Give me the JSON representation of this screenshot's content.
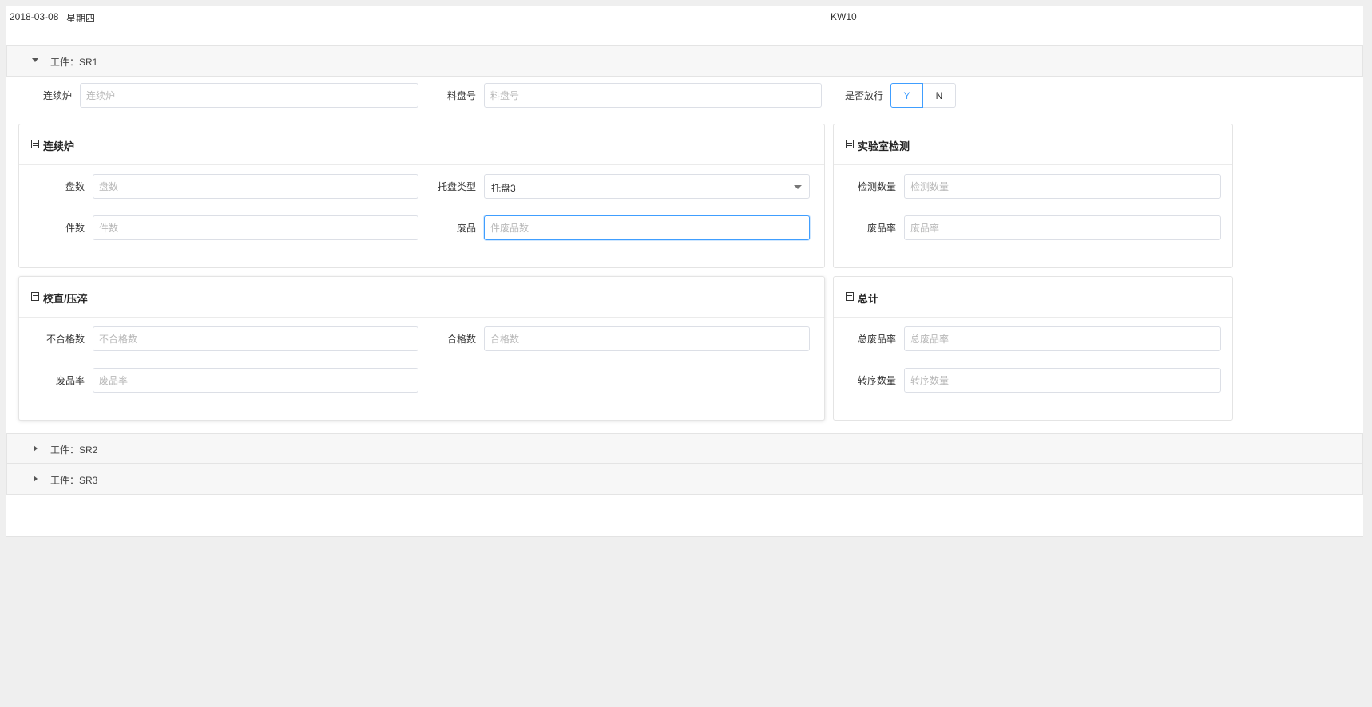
{
  "header": {
    "date": "2018-03-08",
    "weekday": "星期四",
    "week": "KW10"
  },
  "sections": [
    {
      "title": "工件：SR1",
      "expanded": true
    },
    {
      "title": "工件：SR2",
      "expanded": false
    },
    {
      "title": "工件：SR3",
      "expanded": false
    }
  ],
  "top_form": {
    "furnace_label": "连续炉",
    "furnace_placeholder": "连续炉",
    "tray_no_label": "料盘号",
    "tray_no_placeholder": "料盘号",
    "release_label": "是否放行",
    "release_yes": "Y",
    "release_no": "N",
    "release_selected": "Y"
  },
  "panel_furnace": {
    "title": "连续炉",
    "tray_count_label": "盘数",
    "tray_count_placeholder": "盘数",
    "tray_type_label": "托盘类型",
    "tray_type_value": "托盘3",
    "piece_count_label": "件数",
    "piece_count_placeholder": "件数",
    "scrap_label": "废品",
    "scrap_placeholder": "件废品数"
  },
  "panel_lab": {
    "title": "实验室检测",
    "test_qty_label": "检测数量",
    "test_qty_placeholder": "检测数量",
    "scrap_rate_label": "废品率",
    "scrap_rate_placeholder": "废品率"
  },
  "panel_straighten": {
    "title": "校直/压淬",
    "fail_label": "不合格数",
    "fail_placeholder": "不合格数",
    "pass_label": "合格数",
    "pass_placeholder": "合格数",
    "scrap_rate_label": "废品率",
    "scrap_rate_placeholder": "废品率"
  },
  "panel_total": {
    "title": "总计",
    "total_scrap_rate_label": "总废品率",
    "total_scrap_rate_placeholder": "总废品率",
    "transfer_qty_label": "转序数量",
    "transfer_qty_placeholder": "转序数量"
  },
  "colors": {
    "accent": "#409eff",
    "border": "#dcdfe6",
    "background": "#efefef"
  }
}
